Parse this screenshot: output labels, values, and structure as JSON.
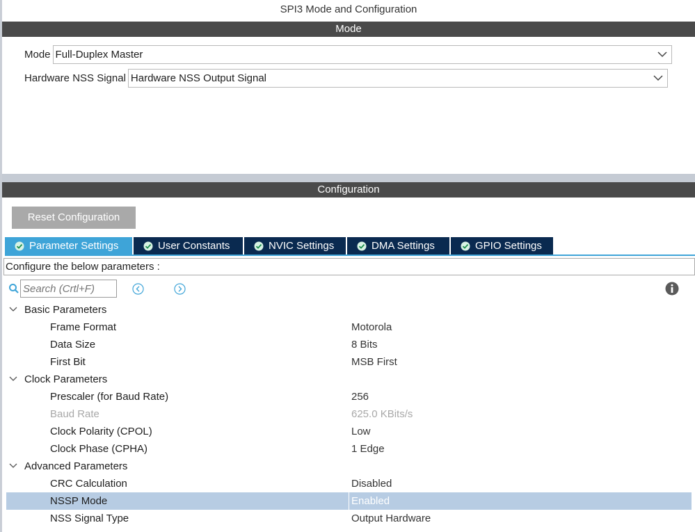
{
  "window": {
    "title": "SPI3 Mode and Configuration"
  },
  "mode_section": {
    "header": "Mode",
    "fields": [
      {
        "label": "Mode",
        "value": "Full-Duplex Master"
      },
      {
        "label": "Hardware NSS Signal",
        "value": "Hardware NSS Output Signal"
      }
    ]
  },
  "config_section": {
    "header": "Configuration",
    "reset_button": "Reset Configuration",
    "tabs": [
      {
        "label": "Parameter Settings",
        "active": true
      },
      {
        "label": "User Constants",
        "active": false
      },
      {
        "label": "NVIC Settings",
        "active": false
      },
      {
        "label": "DMA Settings",
        "active": false
      },
      {
        "label": "GPIO Settings",
        "active": false
      }
    ],
    "hint": "Configure the below parameters :",
    "search": {
      "placeholder": "Search (Crtl+F)"
    },
    "icons": {
      "search": "search-icon",
      "prev": "chevron-left-circle-icon",
      "next": "chevron-right-circle-icon",
      "info": "info-icon",
      "tab_status": "check-circle-icon"
    },
    "groups": [
      {
        "name": "Basic Parameters",
        "params": [
          {
            "name": "Frame Format",
            "value": "Motorola"
          },
          {
            "name": "Data Size",
            "value": "8 Bits"
          },
          {
            "name": "First Bit",
            "value": "MSB First"
          }
        ]
      },
      {
        "name": "Clock Parameters",
        "params": [
          {
            "name": "Prescaler (for Baud Rate)",
            "value": "256"
          },
          {
            "name": "Baud Rate",
            "value": "625.0 KBits/s",
            "disabled": true
          },
          {
            "name": "Clock Polarity (CPOL)",
            "value": "Low"
          },
          {
            "name": "Clock Phase (CPHA)",
            "value": "1 Edge"
          }
        ]
      },
      {
        "name": "Advanced Parameters",
        "params": [
          {
            "name": "CRC Calculation",
            "value": "Disabled"
          },
          {
            "name": "NSSP Mode",
            "value": "Enabled",
            "selected": true
          },
          {
            "name": "NSS Signal Type",
            "value": "Output Hardware"
          }
        ]
      }
    ]
  },
  "colors": {
    "section_bar": "#4a4a4a",
    "tab_active": "#3ea4d8",
    "tab_inactive": "#0a2a50",
    "selected_row": "#b7cce3",
    "icon_accent": "#3ea4d8"
  }
}
